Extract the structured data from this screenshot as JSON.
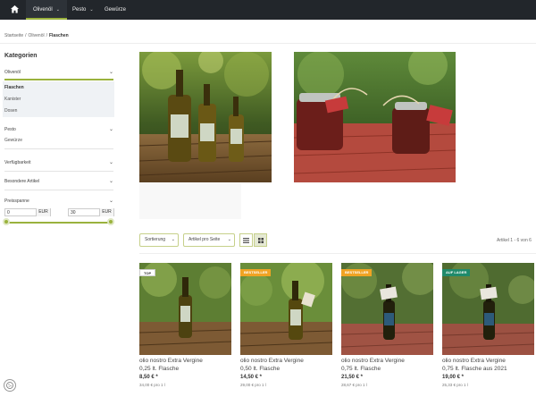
{
  "nav": {
    "items": [
      {
        "label": "Olivenöl",
        "chevron": "⌄"
      },
      {
        "label": "Pesto",
        "chevron": "⌄"
      },
      {
        "label": "Gewürze"
      }
    ],
    "accent": "#9ab23d",
    "bg": "#22262b"
  },
  "breadcrumb": [
    "Startseite",
    "Olivenöl",
    "Flaschen"
  ],
  "sidebar": {
    "title": "Kategorien",
    "sections": [
      {
        "label": "Olivenöl",
        "items": [
          "Flaschen",
          "Kanister",
          "Dosen"
        ],
        "selected": "Flaschen"
      },
      {
        "label": "Pesto",
        "items": [
          "Gewürze"
        ]
      },
      {
        "label": "Verfügbarkeit"
      },
      {
        "label": "Besondere Artikel"
      },
      {
        "label": "Preisspanne"
      }
    ],
    "price_min": {
      "value": "0",
      "unit": "EUR"
    },
    "price_max": {
      "value": "30",
      "unit": "EUR"
    }
  },
  "toolbar": {
    "sort_label": "Sortierung",
    "per_page_label": "Artikel pro Seite",
    "count_text": "Artikel 1 - 6 von 6"
  },
  "products": [
    {
      "badge": "Top",
      "name": "olio nostro Extra Vergine",
      "size": "0,25 lt. Flasche",
      "price": "8,50 € *",
      "unit_price": "34,00 € pro 1 l"
    },
    {
      "badge": "Bestseller",
      "name": "olio nostro Extra Vergine",
      "size": "0,50 lt. Flasche",
      "price": "14,50 € *",
      "unit_price": "29,00 € pro 1 l"
    },
    {
      "badge": "Bestseller",
      "name": "olio nostro Extra Vergine",
      "size": "0,75 lt. Flasche",
      "price": "21,50 € *",
      "unit_price": "28,67 € pro 1 l"
    },
    {
      "badge": "Auf Lager",
      "name": "olio nostro Extra Vergine",
      "size": "0,75 lt. Flasche aus 2021",
      "price": "19,00 € *",
      "unit_price": "25,33 € pro 1 l"
    }
  ],
  "badge_colors": {
    "top": "#ffffff",
    "bestseller": "#f0a323",
    "auf_lager": "#1f8a6b"
  },
  "icons": [
    "home-icon",
    "chevron-down-icon",
    "list-view-icon",
    "grid-view-icon",
    "cookie-settings-icon"
  ]
}
